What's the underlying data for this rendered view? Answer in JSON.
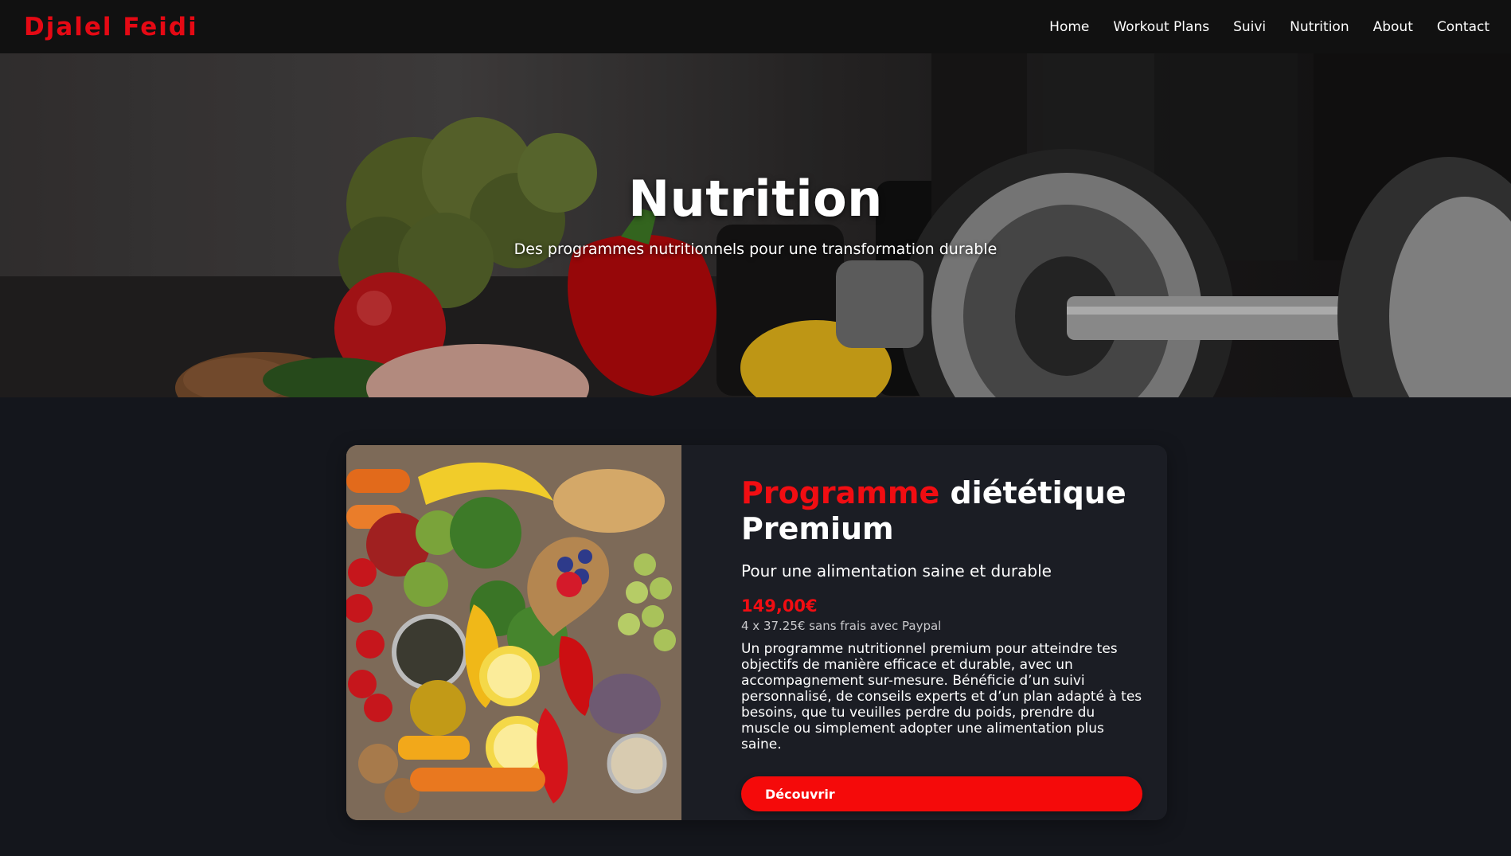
{
  "navbar": {
    "brand": "Djalel Feidi",
    "links": [
      "Home",
      "Workout Plans",
      "Suivi",
      "Nutrition",
      "About",
      "Contact"
    ]
  },
  "hero": {
    "title": "Nutrition",
    "subtitle": "Des programmes nutritionnels pour une transformation durable"
  },
  "product": {
    "title_accent": "Programme",
    "title_rest": " diététique Premium",
    "tagline": "Pour une alimentation saine et durable",
    "price": "149,00€",
    "installments": "4 x 37.25€ sans frais avec Paypal",
    "description": "Un programme nutritionnel premium pour atteindre tes objectifs de manière efficace et durable, avec un accompagnement sur-mesure. Bénéficie d’un suivi personnalisé, de conseils experts et d’un plan adapté à tes besoins, que tu veuilles perdre du poids, prendre du muscle ou simplement adopter une alimentation plus saine.",
    "button_label": "Découvrir"
  },
  "colors": {
    "accent": "#f10d12",
    "navbar_bg": "#111111",
    "page_bg": "#14161c",
    "card_bg": "#1b1d24"
  }
}
